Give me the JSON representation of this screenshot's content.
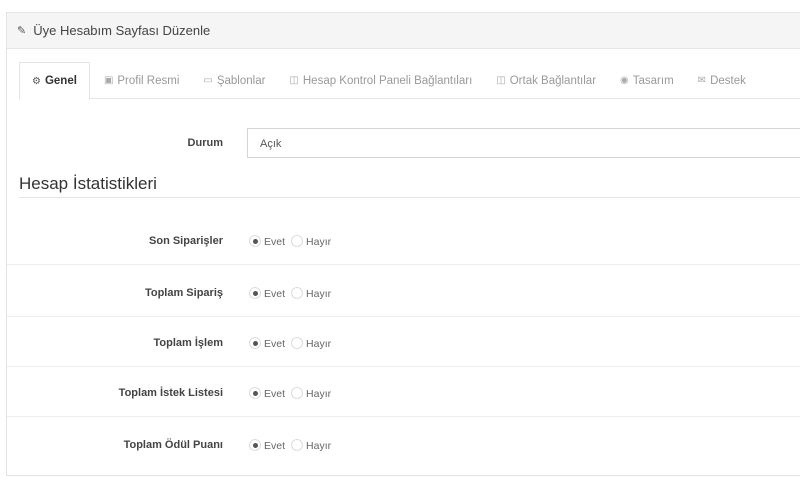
{
  "header": {
    "title": "Üye Hesabım Sayfası Düzenle",
    "icon": "pencil-icon"
  },
  "tabs": [
    {
      "label": "Genel",
      "icon": "cogs-icon",
      "active": true
    },
    {
      "label": "Profil Resmi",
      "icon": "picture-icon"
    },
    {
      "label": "Şablonlar",
      "icon": "desktop-icon"
    },
    {
      "label": "Hesap Kontrol Paneli Bağlantıları",
      "icon": "columns-icon"
    },
    {
      "label": "Ortak Bağlantılar",
      "icon": "columns-icon"
    },
    {
      "label": "Tasarım",
      "icon": "eye-slash-icon"
    },
    {
      "label": "Destek",
      "icon": "envelope-icon"
    }
  ],
  "status": {
    "label": "Durum",
    "value": "Açık"
  },
  "section_title": "Hesap İstatistikleri",
  "options": {
    "yes": "Evet",
    "no": "Hayır"
  },
  "stats": [
    {
      "label": "Son Siparişler",
      "selected": "yes"
    },
    {
      "label": "Toplam Sipariş",
      "selected": "yes"
    },
    {
      "label": "Toplam İşlem",
      "selected": "yes"
    },
    {
      "label": "Toplam İstek Listesi",
      "selected": "yes"
    },
    {
      "label": "Toplam Ödül Puanı",
      "selected": "yes"
    }
  ]
}
